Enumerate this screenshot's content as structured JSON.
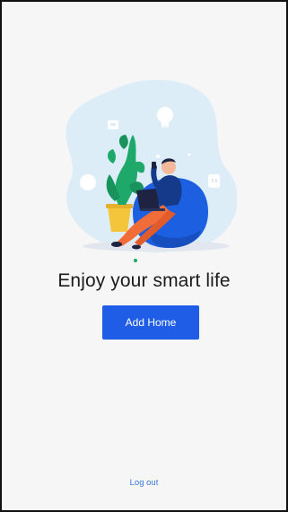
{
  "welcome": {
    "title": "Enjoy your smart life",
    "add_home_label": "Add Home",
    "logout_label": "Log out"
  },
  "colors": {
    "primary_button": "#1f5de6",
    "link": "#3a78d8",
    "background": "#f6f6f7",
    "illustration_blob": "#dcedf7",
    "beanbag": "#1c5fe0",
    "plant": "#1ea86a",
    "pants": "#f06d3a"
  },
  "illustration": {
    "icons": [
      "bulb-icon",
      "tv-icon",
      "socket-icon",
      "speaker-icon"
    ]
  }
}
